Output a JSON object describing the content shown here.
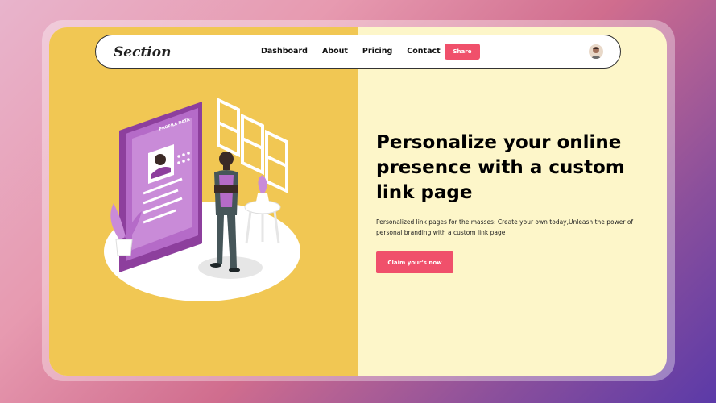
{
  "nav": {
    "brand": "Section",
    "links": [
      "Dashboard",
      "About",
      "Pricing",
      "Contact"
    ],
    "share_label": "Share"
  },
  "hero": {
    "headline": "Personalize your online presence with a custom link page",
    "subtext": "Personalized link pages for the masses: Create your own today,Unleash the power of personal branding with a custom link page",
    "cta_label": "Claim your's now"
  },
  "illustration": {
    "profile_card_title": "PROFILE DATA"
  },
  "colors": {
    "accent": "#f0506b",
    "left_panel": "#f1c753",
    "right_panel": "#fdf6c9",
    "illustration_purple": "#b56bc8"
  }
}
